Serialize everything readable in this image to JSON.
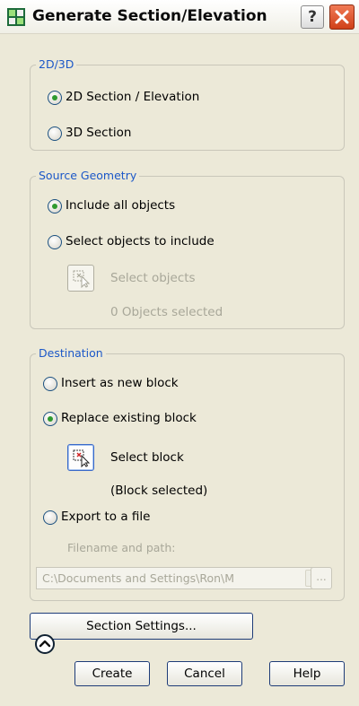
{
  "window": {
    "title": "Generate Section/Elevation",
    "help_label": "?"
  },
  "group_2d3d": {
    "title": "2D/3D",
    "options": [
      "2D Section / Elevation",
      "3D Section"
    ],
    "selected": 0
  },
  "group_source": {
    "title": "Source Geometry",
    "options": [
      "Include all objects",
      "Select objects to include"
    ],
    "selected": 0,
    "select_objects_label": "Select objects",
    "objects_status": "0 Objects selected"
  },
  "group_destination": {
    "title": "Destination",
    "options": [
      "Insert as new block",
      "Replace existing block",
      "Export to a file"
    ],
    "selected": 1,
    "select_block_label": "Select block",
    "block_status": "(Block selected)",
    "filename_label": "Filename and path:",
    "filename_value": "C:\\Documents and Settings\\Ron\\M",
    "browse_label": "..."
  },
  "buttons": {
    "section_settings": "Section Settings...",
    "create": "Create",
    "cancel": "Cancel",
    "help": "Help"
  },
  "icons": [
    "app-icon",
    "help-icon",
    "close-icon",
    "select-objects-icon",
    "select-block-icon",
    "expand-icon",
    "dropdown-arrow-icon"
  ],
  "colors": {
    "dialog_bg": "#ece9d8",
    "group_title": "#1c58c8",
    "close_button": "#d04018",
    "radio_selected": "#2f9a2f",
    "disabled_text": "#a8a799"
  }
}
